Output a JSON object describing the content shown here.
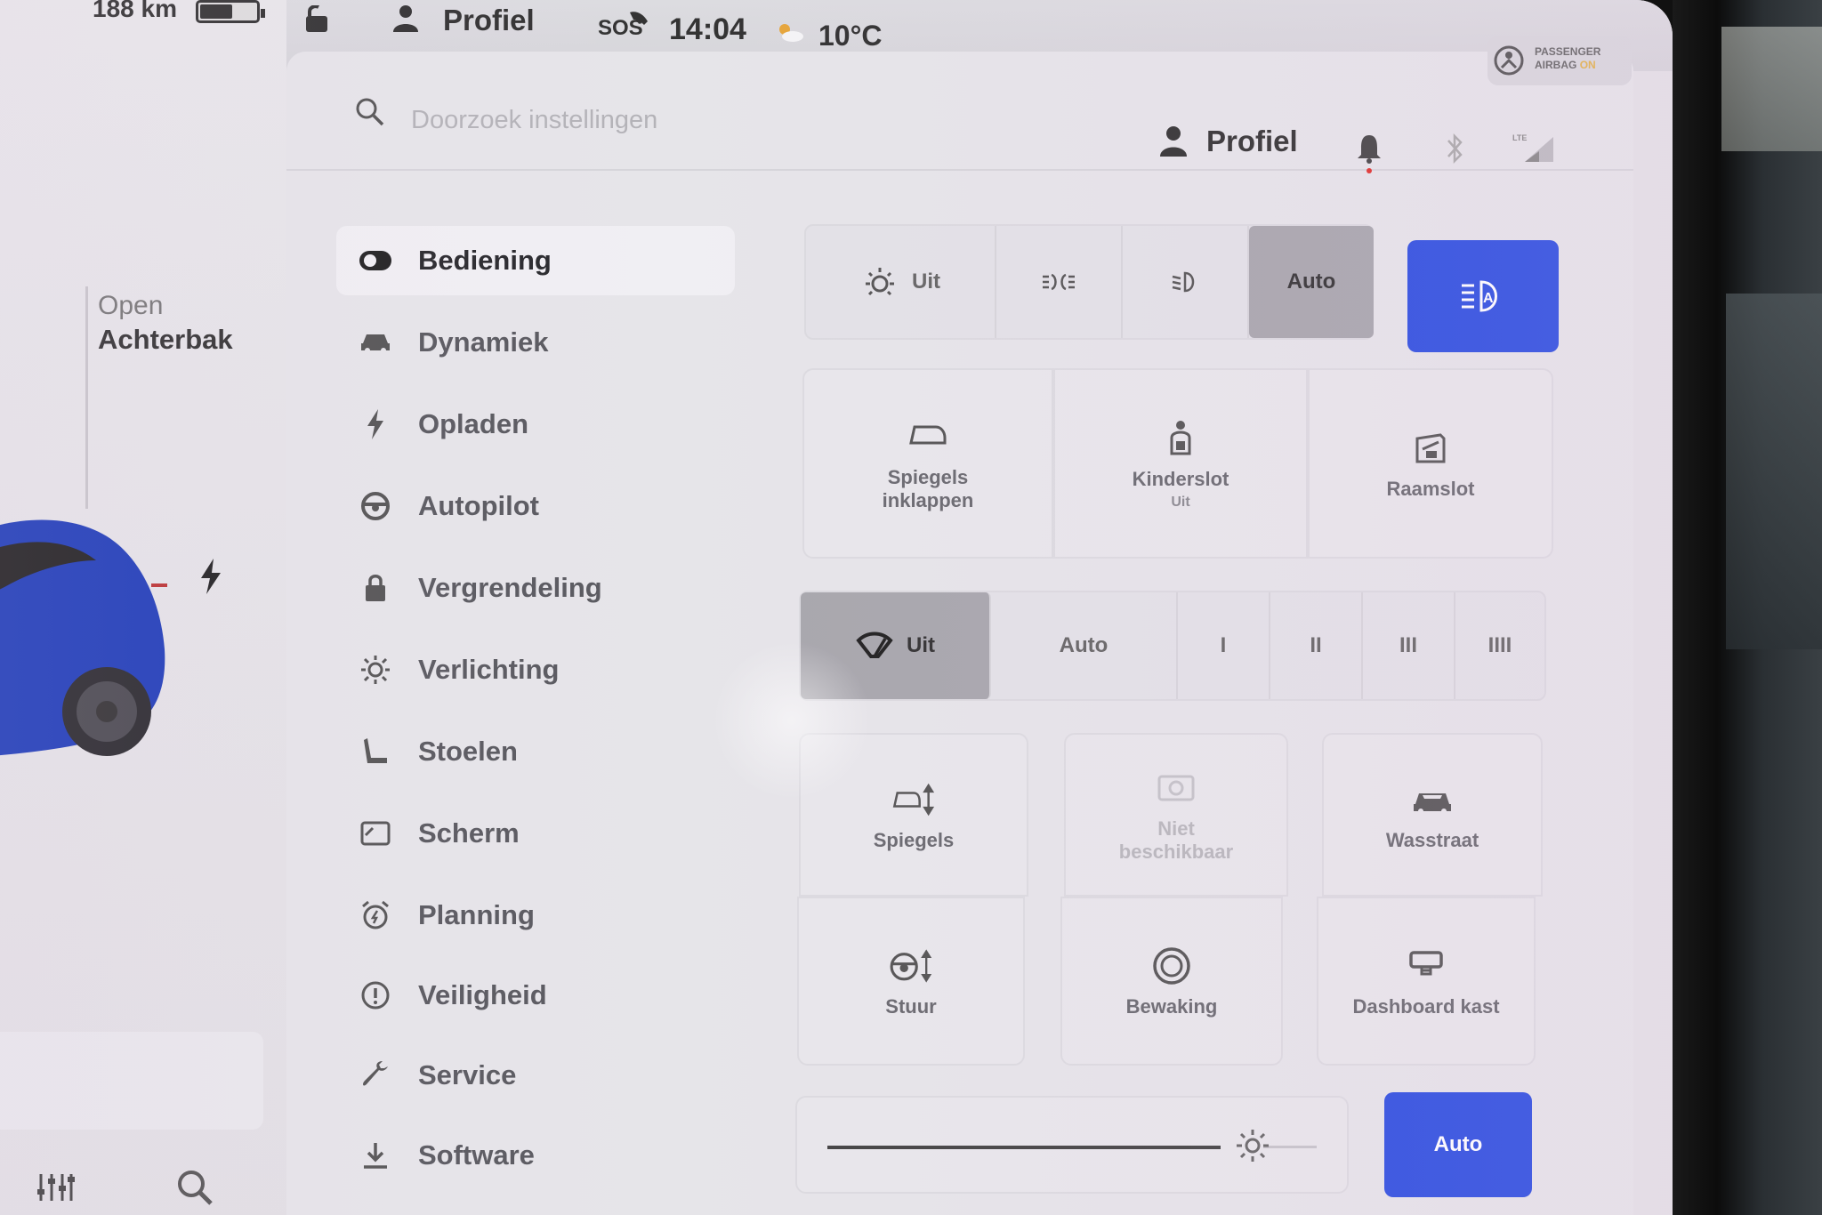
{
  "status_bar": {
    "range": "188 km",
    "profile_label": "Profiel",
    "sos_label": "SOS",
    "time": "14:04",
    "temperature": "10°C",
    "airbag_line1": "PASSENGER",
    "airbag_line2": "AIRBAG",
    "airbag_state": "ON"
  },
  "car_panel": {
    "trunk_line1": "Open",
    "trunk_line2": "Achterbak",
    "car_color": "#1f3db8"
  },
  "header": {
    "search_placeholder": "Doorzoek instellingen",
    "profile_label": "Profiel"
  },
  "sidebar": {
    "items": [
      {
        "label": "Bediening",
        "icon": "toggle-icon",
        "active": true
      },
      {
        "label": "Dynamiek",
        "icon": "car-icon"
      },
      {
        "label": "Opladen",
        "icon": "bolt-icon"
      },
      {
        "label": "Autopilot",
        "icon": "steering-wheel-icon"
      },
      {
        "label": "Vergrendeling",
        "icon": "lock-icon"
      },
      {
        "label": "Verlichting",
        "icon": "sun-icon"
      },
      {
        "label": "Stoelen",
        "icon": "seat-icon"
      },
      {
        "label": "Scherm",
        "icon": "display-icon"
      },
      {
        "label": "Planning",
        "icon": "alarm-clock-icon"
      },
      {
        "label": "Veiligheid",
        "icon": "alert-circle-icon"
      },
      {
        "label": "Service",
        "icon": "wrench-icon"
      },
      {
        "label": "Software",
        "icon": "download-icon"
      }
    ]
  },
  "lights": {
    "off_label": "Uit",
    "auto_label": "Auto",
    "selected": "Auto",
    "auto_highbeam_active": true
  },
  "tiles_row1": [
    {
      "label": "Spiegels inklappen",
      "icon": "mirror-fold-icon"
    },
    {
      "label": "Kinderslot",
      "sub": "Uit",
      "icon": "child-lock-icon"
    },
    {
      "label": "Raamslot",
      "icon": "window-lock-icon"
    }
  ],
  "wipers": {
    "off_label": "Uit",
    "auto_label": "Auto",
    "speeds": [
      "I",
      "II",
      "III",
      "IIII"
    ],
    "selected": "Uit"
  },
  "tiles_row2": [
    {
      "label": "Spiegels",
      "icon": "mirror-adjust-icon"
    },
    {
      "label": "Niet beschikbaar",
      "icon": "dashcam-icon",
      "disabled": true
    },
    {
      "label": "Wasstraat",
      "icon": "car-wash-icon"
    }
  ],
  "tiles_row3": [
    {
      "label": "Stuur",
      "icon": "steering-adjust-icon"
    },
    {
      "label": "Bewaking",
      "icon": "sentry-icon"
    },
    {
      "label": "Dashboard kast",
      "icon": "glovebox-icon"
    }
  ],
  "brightness": {
    "auto_label": "Auto",
    "level": 0.82
  },
  "colors": {
    "accent_blue": "#2d4fe0",
    "selected_gray": "#a8a7ad",
    "panel_bg": "#e6e5e9"
  }
}
